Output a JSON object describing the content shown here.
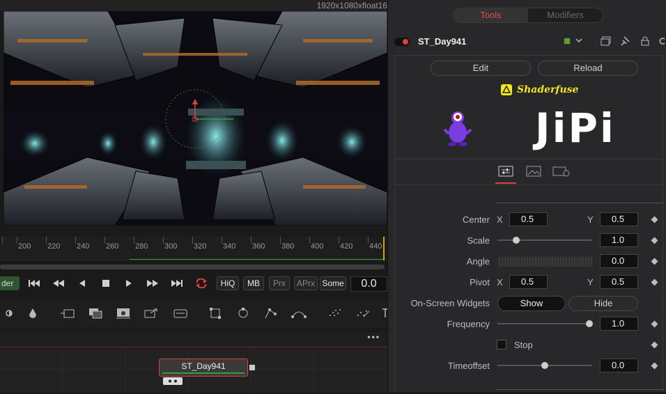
{
  "viewer": {
    "resolution": "1920x1080xfloat16",
    "ruler_ticks": [
      "200",
      "220",
      "240",
      "260",
      "280",
      "300",
      "320",
      "340",
      "360",
      "380",
      "400",
      "420",
      "440"
    ],
    "render_label": "der",
    "transport": {
      "hiq": "HiQ",
      "mb": "MB",
      "prx": "Prx",
      "aprx": "APrx",
      "some": "Some",
      "frame": "0.0"
    }
  },
  "node": {
    "label": "ST_Day941"
  },
  "panel": {
    "tabs": {
      "tools": "Tools",
      "modifiers": "Modifiers"
    },
    "tool_name": "ST_Day941",
    "edit": "Edit",
    "reload": "Reload",
    "shaderfuse": "Shaderfuse",
    "jipi": "JiPi",
    "params": {
      "center": {
        "label": "Center",
        "x_label": "X",
        "x": "0.5",
        "y_label": "Y",
        "y": "0.5"
      },
      "scale": {
        "label": "Scale",
        "value": "1.0",
        "level": 0.2
      },
      "angle": {
        "label": "Angle",
        "value": "0.0"
      },
      "pivot": {
        "label": "Pivot",
        "x_label": "X",
        "x": "0.5",
        "y_label": "Y",
        "y": "0.5"
      },
      "widgets": {
        "label": "On-Screen Widgets",
        "show": "Show",
        "hide": "Hide"
      },
      "frequency": {
        "label": "Frequency",
        "value": "1.0",
        "level": 0.97
      },
      "stop": {
        "label": "Stop"
      },
      "timeoffset": {
        "label": "Timeoffset",
        "value": "0.0",
        "level": 0.5
      }
    }
  },
  "colors": {
    "accent": "#e04040",
    "range": "#3c9a3c",
    "playhead": "#d8a400",
    "shaderfuse": "#f3e61a"
  }
}
